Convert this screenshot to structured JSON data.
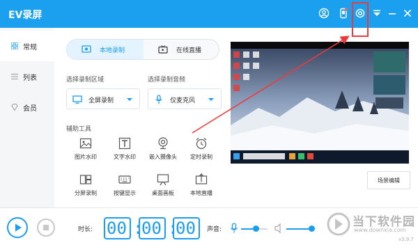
{
  "app": {
    "title": "EV录屏",
    "version": "v3.9.7"
  },
  "titlebar": {
    "icons": [
      "user-circle-icon",
      "phone-icon",
      "settings-icon",
      "menu-icon",
      "minimize-icon",
      "close-icon"
    ]
  },
  "sidebar": {
    "items": [
      {
        "label": "常规",
        "icon": "grid-icon",
        "active": true
      },
      {
        "label": "列表",
        "icon": "list-icon",
        "active": false
      },
      {
        "label": "会员",
        "icon": "diamond-icon",
        "active": false
      }
    ]
  },
  "tabs": [
    {
      "label": "本地录制",
      "icon": "screen-record-icon",
      "active": true
    },
    {
      "label": "在线直播",
      "icon": "tv-icon",
      "active": false
    }
  ],
  "record_area": {
    "title": "选择录制区域",
    "value": "全屏录制",
    "icon": "monitor-icon"
  },
  "record_audio": {
    "title": "选择录制音频",
    "value": "仅麦克风",
    "icon": "microphone-icon"
  },
  "tools": {
    "title": "辅助工具",
    "items": [
      {
        "label": "图片水印",
        "icon": "image-icon"
      },
      {
        "label": "文字水印",
        "icon": "text-t-icon"
      },
      {
        "label": "嵌入摄像头",
        "icon": "webcam-icon"
      },
      {
        "label": "定时录制",
        "icon": "alarm-clock-icon"
      },
      {
        "label": "分屏录制",
        "icon": "split-screen-icon"
      },
      {
        "label": "按键显示",
        "icon": "keyboard-icon"
      },
      {
        "label": "桌面画板",
        "icon": "whiteboard-icon"
      },
      {
        "label": "本地直播",
        "icon": "live-upload-icon"
      }
    ]
  },
  "scene_button": {
    "label": "场景编辑"
  },
  "bottom": {
    "duration_label": "时长:",
    "timer": {
      "h": "00",
      "m": "00",
      "s": "00",
      "sep": ":"
    },
    "volume_label": "声音:",
    "mic_level": 0.55,
    "speaker_level": 1.0
  },
  "brand": {
    "name": "当下软件园",
    "url": "www.downxia.com"
  },
  "colors": {
    "accent": "#1aa0ee",
    "annotation": "#ee3a3a"
  }
}
